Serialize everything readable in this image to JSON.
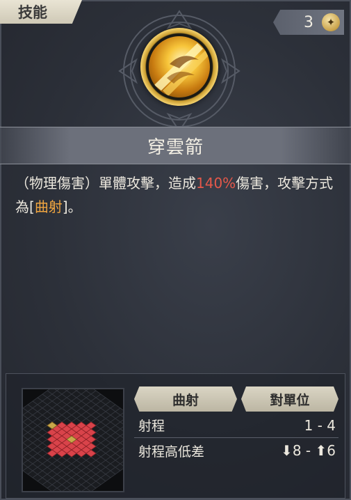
{
  "tab": {
    "label": "技能"
  },
  "points": {
    "value": "3",
    "icon": "star-coin-icon"
  },
  "skill": {
    "icon": "golden-arrow-skill-icon",
    "name": "穿雲箭",
    "description": {
      "part1": "（物理傷害）單體攻擊，造成",
      "damage": "140%",
      "part2": "傷害，攻擊方式為[",
      "attack_type": "曲射",
      "part3": "]。"
    }
  },
  "stats": {
    "header_attack_type": "曲射",
    "header_target": "對單位",
    "rows": [
      {
        "label": "射程",
        "value": "1 - 4"
      },
      {
        "label": "射程高低差",
        "value": "⬇8 - ⬆6"
      }
    ]
  },
  "colors": {
    "damage_highlight": "#e5584a",
    "attack_type_highlight": "#f1a640",
    "range_cell": "#d9434a",
    "origin_cell": "#c9a84a"
  }
}
